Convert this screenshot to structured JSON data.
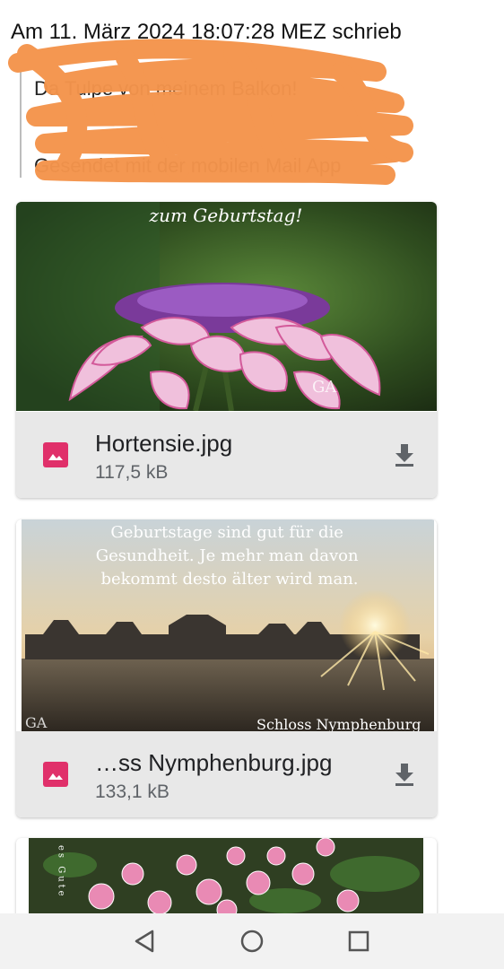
{
  "header": {
    "line": "Am 11. März 2024 18:07:28 MEZ schrieb"
  },
  "quoted": {
    "line1": "Da          Tulpe von  meinem Balkon!",
    "line2": "Gesendet mit der mobilen Mail App"
  },
  "attachments": [
    {
      "image_text": "zum Geburtstag!",
      "watermark": "GA",
      "name": "Hortensie.jpg",
      "size": "117,5 kB"
    },
    {
      "image_text_lines": [
        "Geburtstage sind gut für die",
        "Gesundheit. Je mehr man davon",
        "bekommt desto älter wird man."
      ],
      "watermark": "GA",
      "caption": "Schloss Nymphenburg",
      "name": "…ss Nymphenburg.jpg",
      "size": "133,1 kB"
    },
    {
      "image_text_vertical": "es Gute"
    }
  ],
  "colors": {
    "file_icon": "#e0306a",
    "scribble": "#f4944c",
    "footer_bg": "#e8e8e8"
  },
  "icons": {
    "file": "image-file-icon",
    "download": "download-icon",
    "nav_back": "back-triangle-icon",
    "nav_home": "home-circle-icon",
    "nav_recents": "recents-square-icon"
  }
}
